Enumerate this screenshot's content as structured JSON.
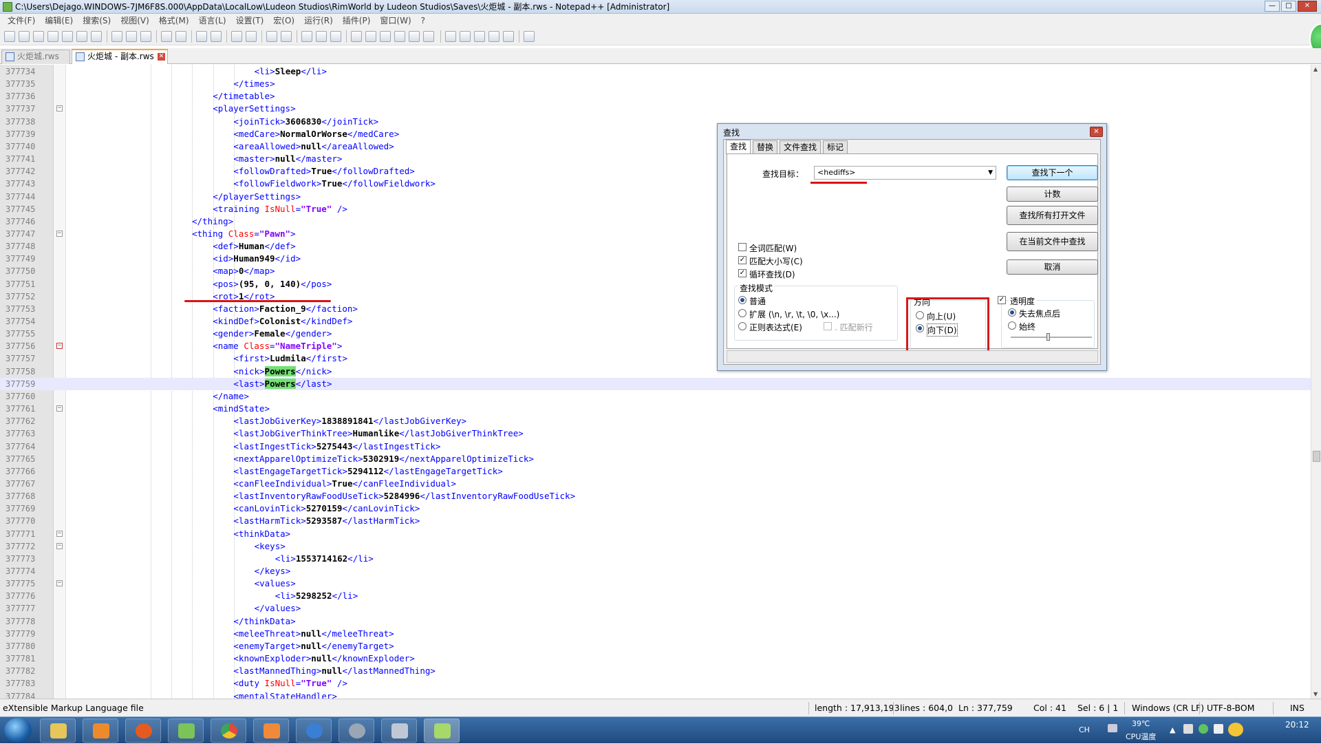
{
  "window": {
    "title": "C:\\Users\\Dejago.WINDOWS-7JM6F8S.000\\AppData\\LocalLow\\Ludeon Studios\\RimWorld by Ludeon Studios\\Saves\\火炬城 - 副本.rws - Notepad++ [Administrator]",
    "controls": {
      "minimize": "—",
      "maximize": "□",
      "close": "✕"
    }
  },
  "menu": [
    "文件(F)",
    "编辑(E)",
    "搜索(S)",
    "视图(V)",
    "格式(M)",
    "语言(L)",
    "设置(T)",
    "宏(O)",
    "运行(R)",
    "插件(P)",
    "窗口(W)",
    "?"
  ],
  "tabs": [
    {
      "label": "火炬城.rws",
      "active": false
    },
    {
      "label": "火炬城 - 副本.rws",
      "active": true
    }
  ],
  "editor": {
    "current_line": "377759",
    "lines": [
      {
        "n": "377734",
        "indent": 8,
        "parts": [
          [
            "tag",
            "<li>"
          ],
          [
            "txt",
            "Sleep"
          ],
          [
            "tag",
            "</li>"
          ]
        ]
      },
      {
        "n": "377735",
        "indent": 6,
        "parts": [
          [
            "tag",
            "</times>"
          ]
        ]
      },
      {
        "n": "377736",
        "indent": 4,
        "parts": [
          [
            "tag",
            "</timetable>"
          ]
        ]
      },
      {
        "n": "377737",
        "indent": 4,
        "fold": "−",
        "parts": [
          [
            "tag",
            "<playerSettings>"
          ]
        ]
      },
      {
        "n": "377738",
        "indent": 6,
        "parts": [
          [
            "tag",
            "<joinTick>"
          ],
          [
            "txt",
            "3606830"
          ],
          [
            "tag",
            "</joinTick>"
          ]
        ]
      },
      {
        "n": "377739",
        "indent": 6,
        "parts": [
          [
            "tag",
            "<medCare>"
          ],
          [
            "txt",
            "NormalOrWorse"
          ],
          [
            "tag",
            "</medCare>"
          ]
        ]
      },
      {
        "n": "377740",
        "indent": 6,
        "parts": [
          [
            "tag",
            "<areaAllowed>"
          ],
          [
            "txt",
            "null"
          ],
          [
            "tag",
            "</areaAllowed>"
          ]
        ]
      },
      {
        "n": "377741",
        "indent": 6,
        "parts": [
          [
            "tag",
            "<master>"
          ],
          [
            "txt",
            "null"
          ],
          [
            "tag",
            "</master>"
          ]
        ]
      },
      {
        "n": "377742",
        "indent": 6,
        "parts": [
          [
            "tag",
            "<followDrafted>"
          ],
          [
            "txt",
            "True"
          ],
          [
            "tag",
            "</followDrafted>"
          ]
        ]
      },
      {
        "n": "377743",
        "indent": 6,
        "parts": [
          [
            "tag",
            "<followFieldwork>"
          ],
          [
            "txt",
            "True"
          ],
          [
            "tag",
            "</followFieldwork>"
          ]
        ]
      },
      {
        "n": "377744",
        "indent": 4,
        "parts": [
          [
            "tag",
            "</playerSettings>"
          ]
        ]
      },
      {
        "n": "377745",
        "indent": 4,
        "parts": [
          [
            "tag",
            "<training "
          ],
          [
            "attr",
            "IsNull"
          ],
          [
            "tag",
            "="
          ],
          [
            "str",
            "\"True\""
          ],
          [
            "tag",
            " />"
          ]
        ]
      },
      {
        "n": "377746",
        "indent": 2,
        "parts": [
          [
            "tag",
            "</thing>"
          ]
        ]
      },
      {
        "n": "377747",
        "indent": 2,
        "fold": "−",
        "parts": [
          [
            "tag",
            "<thing "
          ],
          [
            "attr",
            "Class"
          ],
          [
            "tag",
            "="
          ],
          [
            "str",
            "\"Pawn\""
          ],
          [
            "tag",
            ">"
          ]
        ]
      },
      {
        "n": "377748",
        "indent": 4,
        "parts": [
          [
            "tag",
            "<def>"
          ],
          [
            "txt",
            "Human"
          ],
          [
            "tag",
            "</def>"
          ]
        ]
      },
      {
        "n": "377749",
        "indent": 4,
        "parts": [
          [
            "tag",
            "<id>"
          ],
          [
            "txt",
            "Human949"
          ],
          [
            "tag",
            "</id>"
          ]
        ]
      },
      {
        "n": "377750",
        "indent": 4,
        "parts": [
          [
            "tag",
            "<map>"
          ],
          [
            "txt",
            "0"
          ],
          [
            "tag",
            "</map>"
          ]
        ]
      },
      {
        "n": "377751",
        "indent": 4,
        "parts": [
          [
            "tag",
            "<pos>"
          ],
          [
            "txt",
            "(95, 0, 140)"
          ],
          [
            "tag",
            "</pos>"
          ]
        ]
      },
      {
        "n": "377752",
        "indent": 4,
        "parts": [
          [
            "tag",
            "<rot>"
          ],
          [
            "txt",
            "1"
          ],
          [
            "tag",
            "</rot>"
          ]
        ]
      },
      {
        "n": "377753",
        "indent": 4,
        "parts": [
          [
            "tag",
            "<faction>"
          ],
          [
            "txt",
            "Faction_9"
          ],
          [
            "tag",
            "</faction>"
          ]
        ]
      },
      {
        "n": "377754",
        "indent": 4,
        "parts": [
          [
            "tag",
            "<kindDef>"
          ],
          [
            "txt",
            "Colonist"
          ],
          [
            "tag",
            "</kindDef>"
          ]
        ]
      },
      {
        "n": "377755",
        "indent": 4,
        "parts": [
          [
            "tag",
            "<gender>"
          ],
          [
            "txt",
            "Female"
          ],
          [
            "tag",
            "</gender>"
          ]
        ]
      },
      {
        "n": "377756",
        "indent": 4,
        "fold": "−",
        "foldred": true,
        "parts": [
          [
            "tag",
            "<name "
          ],
          [
            "attr",
            "Class"
          ],
          [
            "tag",
            "="
          ],
          [
            "str",
            "\"NameTriple\""
          ],
          [
            "tag",
            ">"
          ]
        ]
      },
      {
        "n": "377757",
        "indent": 6,
        "parts": [
          [
            "tag",
            "<first>"
          ],
          [
            "txt",
            "Ludmila"
          ],
          [
            "tag",
            "</first>"
          ]
        ]
      },
      {
        "n": "377758",
        "indent": 6,
        "parts": [
          [
            "tag",
            "<nick>"
          ],
          [
            "hl",
            "Powers"
          ],
          [
            "tag",
            "</nick>"
          ]
        ]
      },
      {
        "n": "377759",
        "indent": 6,
        "parts": [
          [
            "tag",
            "<last>"
          ],
          [
            "hl",
            "Powers"
          ],
          [
            "tag",
            "</last>"
          ]
        ]
      },
      {
        "n": "377760",
        "indent": 4,
        "parts": [
          [
            "tag",
            "</name>"
          ]
        ]
      },
      {
        "n": "377761",
        "indent": 4,
        "fold": "−",
        "parts": [
          [
            "tag",
            "<mindState>"
          ]
        ]
      },
      {
        "n": "377762",
        "indent": 6,
        "parts": [
          [
            "tag",
            "<lastJobGiverKey>"
          ],
          [
            "txt",
            "1838891841"
          ],
          [
            "tag",
            "</lastJobGiverKey>"
          ]
        ]
      },
      {
        "n": "377763",
        "indent": 6,
        "parts": [
          [
            "tag",
            "<lastJobGiverThinkTree>"
          ],
          [
            "txt",
            "Humanlike"
          ],
          [
            "tag",
            "</lastJobGiverThinkTree>"
          ]
        ]
      },
      {
        "n": "377764",
        "indent": 6,
        "parts": [
          [
            "tag",
            "<lastIngestTick>"
          ],
          [
            "txt",
            "5275443"
          ],
          [
            "tag",
            "</lastIngestTick>"
          ]
        ]
      },
      {
        "n": "377765",
        "indent": 6,
        "parts": [
          [
            "tag",
            "<nextApparelOptimizeTick>"
          ],
          [
            "txt",
            "5302919"
          ],
          [
            "tag",
            "</nextApparelOptimizeTick>"
          ]
        ]
      },
      {
        "n": "377766",
        "indent": 6,
        "parts": [
          [
            "tag",
            "<lastEngageTargetTick>"
          ],
          [
            "txt",
            "5294112"
          ],
          [
            "tag",
            "</lastEngageTargetTick>"
          ]
        ]
      },
      {
        "n": "377767",
        "indent": 6,
        "parts": [
          [
            "tag",
            "<canFleeIndividual>"
          ],
          [
            "txt",
            "True"
          ],
          [
            "tag",
            "</canFleeIndividual>"
          ]
        ]
      },
      {
        "n": "377768",
        "indent": 6,
        "parts": [
          [
            "tag",
            "<lastInventoryRawFoodUseTick>"
          ],
          [
            "txt",
            "5284996"
          ],
          [
            "tag",
            "</lastInventoryRawFoodUseTick>"
          ]
        ]
      },
      {
        "n": "377769",
        "indent": 6,
        "parts": [
          [
            "tag",
            "<canLovinTick>"
          ],
          [
            "txt",
            "5270159"
          ],
          [
            "tag",
            "</canLovinTick>"
          ]
        ]
      },
      {
        "n": "377770",
        "indent": 6,
        "parts": [
          [
            "tag",
            "<lastHarmTick>"
          ],
          [
            "txt",
            "5293587"
          ],
          [
            "tag",
            "</lastHarmTick>"
          ]
        ]
      },
      {
        "n": "377771",
        "indent": 6,
        "fold": "−",
        "parts": [
          [
            "tag",
            "<thinkData>"
          ]
        ]
      },
      {
        "n": "377772",
        "indent": 8,
        "fold": "−",
        "parts": [
          [
            "tag",
            "<keys>"
          ]
        ]
      },
      {
        "n": "377773",
        "indent": 10,
        "parts": [
          [
            "tag",
            "<li>"
          ],
          [
            "txt",
            "1553714162"
          ],
          [
            "tag",
            "</li>"
          ]
        ]
      },
      {
        "n": "377774",
        "indent": 8,
        "parts": [
          [
            "tag",
            "</keys>"
          ]
        ]
      },
      {
        "n": "377775",
        "indent": 8,
        "fold": "−",
        "parts": [
          [
            "tag",
            "<values>"
          ]
        ]
      },
      {
        "n": "377776",
        "indent": 10,
        "parts": [
          [
            "tag",
            "<li>"
          ],
          [
            "txt",
            "5298252"
          ],
          [
            "tag",
            "</li>"
          ]
        ]
      },
      {
        "n": "377777",
        "indent": 8,
        "parts": [
          [
            "tag",
            "</values>"
          ]
        ]
      },
      {
        "n": "377778",
        "indent": 6,
        "parts": [
          [
            "tag",
            "</thinkData>"
          ]
        ]
      },
      {
        "n": "377779",
        "indent": 6,
        "parts": [
          [
            "tag",
            "<meleeThreat>"
          ],
          [
            "txt",
            "null"
          ],
          [
            "tag",
            "</meleeThreat>"
          ]
        ]
      },
      {
        "n": "377780",
        "indent": 6,
        "parts": [
          [
            "tag",
            "<enemyTarget>"
          ],
          [
            "txt",
            "null"
          ],
          [
            "tag",
            "</enemyTarget>"
          ]
        ]
      },
      {
        "n": "377781",
        "indent": 6,
        "parts": [
          [
            "tag",
            "<knownExploder>"
          ],
          [
            "txt",
            "null"
          ],
          [
            "tag",
            "</knownExploder>"
          ]
        ]
      },
      {
        "n": "377782",
        "indent": 6,
        "parts": [
          [
            "tag",
            "<lastMannedThing>"
          ],
          [
            "txt",
            "null"
          ],
          [
            "tag",
            "</lastMannedThing>"
          ]
        ]
      },
      {
        "n": "377783",
        "indent": 6,
        "parts": [
          [
            "tag",
            "<duty "
          ],
          [
            "attr",
            "IsNull"
          ],
          [
            "tag",
            "="
          ],
          [
            "str",
            "\"True\""
          ],
          [
            "tag",
            " />"
          ]
        ]
      },
      {
        "n": "377784",
        "indent": 6,
        "parts": [
          [
            "tag",
            "<mentalStateHandler>"
          ]
        ]
      }
    ]
  },
  "find_dialog": {
    "title": "查找",
    "close": "✕",
    "tabs": [
      "查找",
      "替换",
      "文件查找",
      "标记"
    ],
    "find_label": "查找目标：",
    "find_value": "<hediffs>",
    "buttons": {
      "find_next": "查找下一个",
      "count": "计数",
      "find_all_open": "查找所有打开文件",
      "find_all_current": "在当前文件中查找",
      "cancel": "取消"
    },
    "options": {
      "whole_word": {
        "label": "全词匹配(W)",
        "checked": false
      },
      "match_case": {
        "label": "匹配大小写(C)",
        "checked": true
      },
      "wrap": {
        "label": "循环查找(D)",
        "checked": true
      }
    },
    "search_mode": {
      "title": "查找模式",
      "normal": "普通",
      "extended": "扩展 (\\n, \\r, \\t, \\0, \\x...)",
      "regex": "正则表达式(E)",
      "dot_newline": ". 匹配新行",
      "selected": "normal"
    },
    "direction": {
      "title": "方向",
      "up": "向上(U)",
      "down": "向下(D)",
      "selected": "down"
    },
    "transparency": {
      "title": "透明度",
      "checked": true,
      "on_lose_focus": "失去焦点后",
      "always": "始终",
      "selected": "on_lose_focus"
    }
  },
  "statusbar": {
    "filetype": "eXtensible Markup Language file",
    "length": "length : 17,913,193",
    "lines": "lines : 604,0",
    "ln": "Ln : 377,759",
    "col": "Col : 41",
    "sel": "Sel : 6 | 1",
    "eol": "Windows (CR LF)",
    "encoding": "UTF-8-BOM",
    "ins": "INS"
  },
  "taskbar": {
    "lang": "CH",
    "temp": "39℃",
    "temp_label": "CPU温度",
    "time": "20:12",
    "app_icons": [
      "start-orb-icon",
      "explorer-icon",
      "media-player-icon",
      "firefox-icon",
      "notepad-green-icon",
      "chrome-icon",
      "paint-icon",
      "globe-icon",
      "settings-wheel-icon",
      "tools-icon",
      "notepadpp-icon"
    ]
  }
}
